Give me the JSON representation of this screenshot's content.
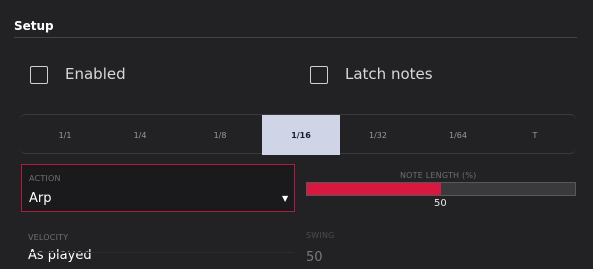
{
  "setup": {
    "title": "Setup"
  },
  "options": {
    "enabled_label": "Enabled",
    "latch_label": "Latch notes"
  },
  "rates": {
    "items": [
      "1/1",
      "1/4",
      "1/8",
      "1/16",
      "1/32",
      "1/64",
      "T"
    ],
    "selected": "1/16"
  },
  "action": {
    "caption": "ACTION",
    "value": "Arp",
    "arrow_icon": "triangle-down-icon"
  },
  "note_length": {
    "caption": "NOTE LENGTH (%)",
    "value": 50,
    "value_text": "50",
    "accent": "#d8183f"
  },
  "velocity": {
    "caption": "VELOCITY",
    "value": "As played"
  },
  "swing": {
    "caption": "SWING",
    "value": "50"
  }
}
